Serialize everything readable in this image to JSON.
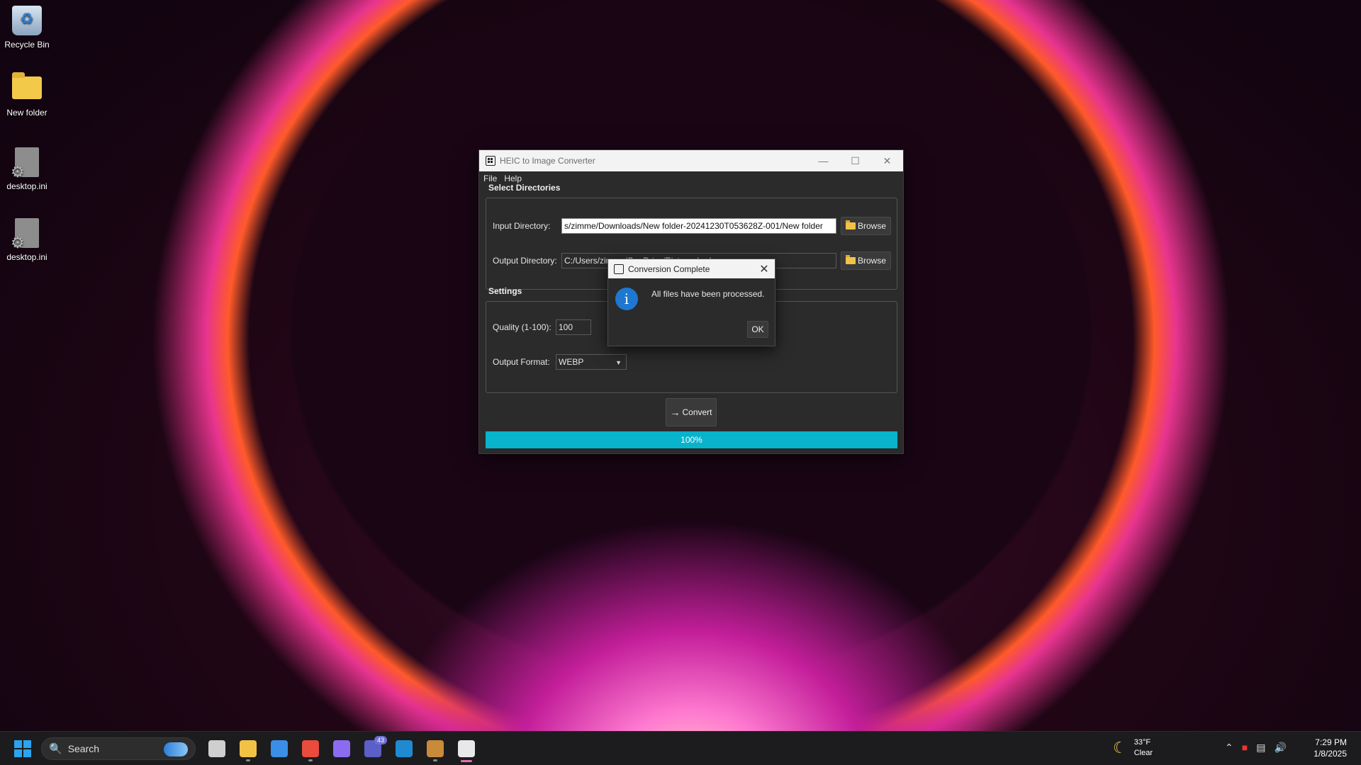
{
  "desktop": {
    "icons": [
      {
        "label": "Recycle Bin"
      },
      {
        "label": "New folder"
      },
      {
        "label": "desktop.ini"
      },
      {
        "label": "desktop.ini"
      }
    ]
  },
  "window": {
    "title": "HEIC to Image Converter",
    "controls": {
      "minimize": "—",
      "maximize": "☐",
      "close": "✕"
    },
    "menu": [
      "File",
      "Help"
    ],
    "directories": {
      "group_title": "Select Directories",
      "input_label": "Input Directory:",
      "input_value": "s/zimme/Downloads/New folder-20241230T053628Z-001/New folder",
      "output_label": "Output Directory:",
      "output_value": "C:/Users/zimme/OneDrive/Pictures/webp",
      "browse_label": "Browse"
    },
    "settings": {
      "group_title": "Settings",
      "quality_label": "Quality (1-100):",
      "quality_value": "100",
      "format_label": "Output Format:",
      "format_value": "WEBP"
    },
    "convert_label": "Convert",
    "progress": {
      "value": 1.0,
      "label": "100%"
    }
  },
  "dialog": {
    "title": "Conversion Complete",
    "message": "All files have been processed.",
    "ok_label": "OK",
    "close_glyph": "✕"
  },
  "taskbar": {
    "search_placeholder": "Search",
    "apps": [
      {
        "name": "task-view-icon",
        "color": "#cfcfcf",
        "state": ""
      },
      {
        "name": "file-explorer-icon",
        "color": "#f2c246",
        "state": "running"
      },
      {
        "name": "microsoft-store-icon",
        "color": "#3a8ee6",
        "state": ""
      },
      {
        "name": "chrome-icon",
        "color": "#e94b3c",
        "state": "running"
      },
      {
        "name": "copilot-icon",
        "color": "#8b6cf0",
        "state": ""
      },
      {
        "name": "teams-icon",
        "color": "#5b5fc7",
        "state": "",
        "badge": "43"
      },
      {
        "name": "vscode-icon",
        "color": "#1f8ad2",
        "state": ""
      },
      {
        "name": "python-app-icon",
        "color": "#c98a3a",
        "state": "running"
      },
      {
        "name": "heic-converter-icon",
        "color": "#e8e8e8",
        "state": "active"
      }
    ],
    "weather": {
      "temp": "33°F",
      "condition": "Clear"
    },
    "clock": {
      "time": "7:29 PM",
      "date": "1/8/2025"
    }
  }
}
